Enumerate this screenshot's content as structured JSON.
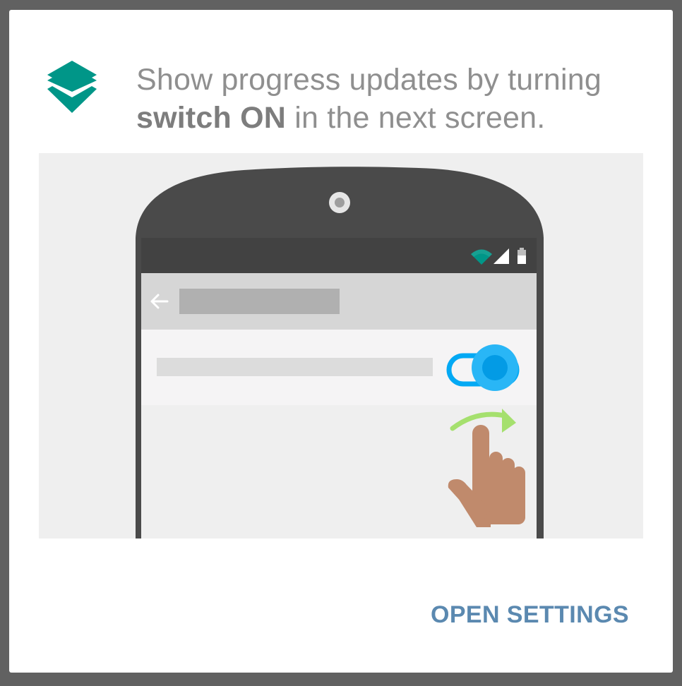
{
  "dialog": {
    "app_icon": "layers-icon",
    "message": {
      "part1": "Show progress updates by turning",
      "bold": "switch ON",
      "part2": "in the next screen."
    },
    "illustration": {
      "phone_icons": [
        "camera-icon",
        "wifi-icon",
        "signal-icon",
        "battery-icon",
        "back-arrow-icon",
        "toggle-switch-icon",
        "swipe-arrow-icon",
        "hand-icon"
      ],
      "toggle_state": "on"
    },
    "actions": {
      "open_settings_label": "OPEN SETTINGS"
    },
    "colors": {
      "accent": "#009688",
      "toggle": "#29b6f6",
      "button_text": "#5b89b0",
      "swipe_arrow": "#a5e06e",
      "hand": "#c08a6c"
    }
  }
}
